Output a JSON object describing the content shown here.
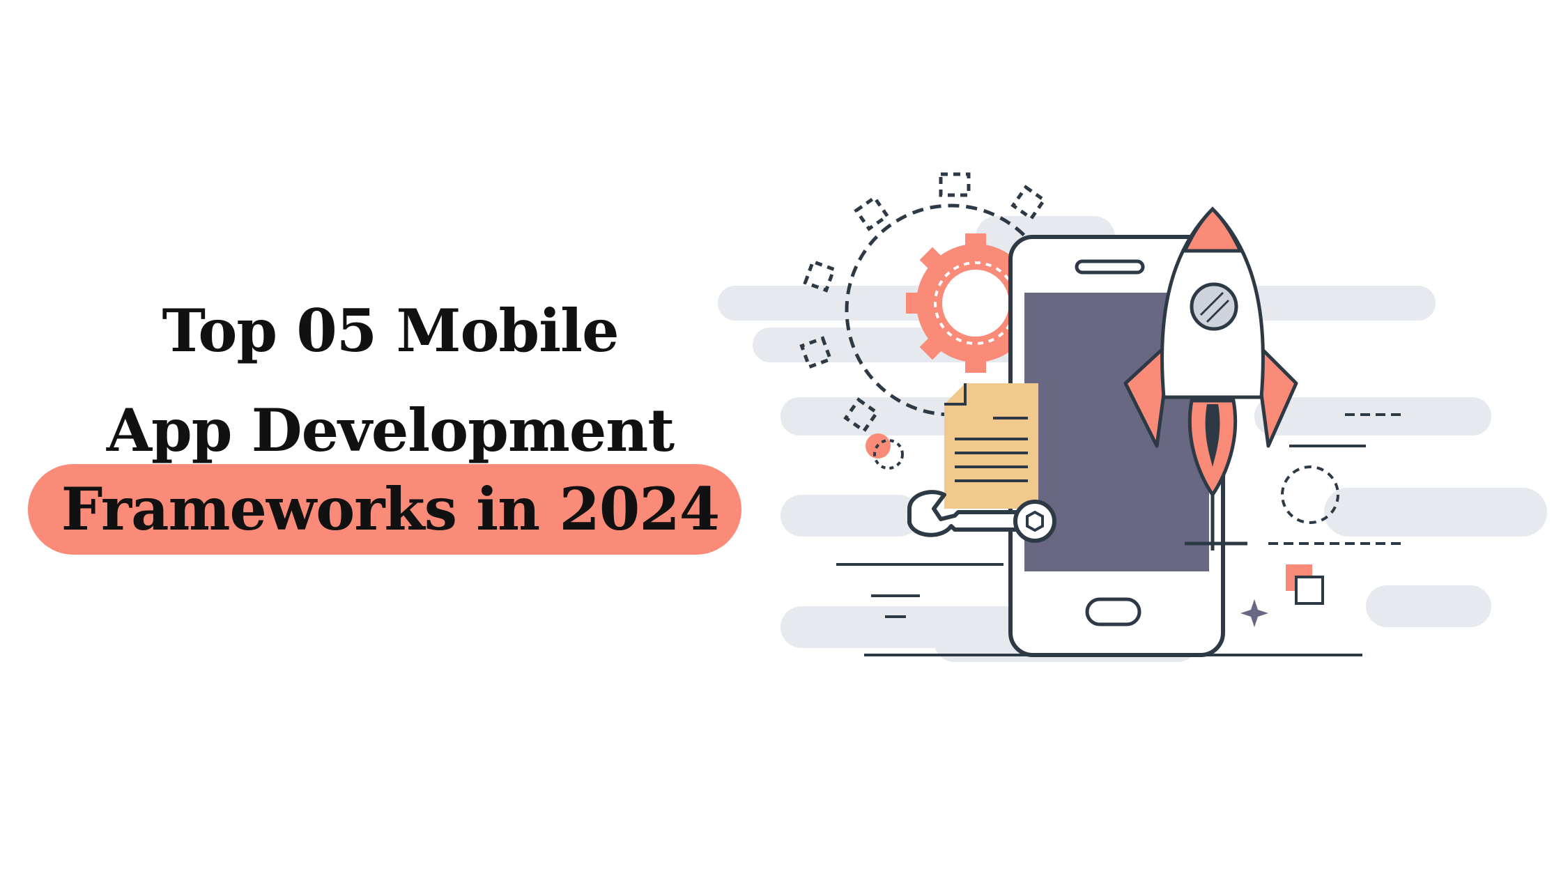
{
  "headline": {
    "line1": "Top 05 Mobile",
    "line2": "App Development",
    "line3": "Frameworks in 2024"
  },
  "colors": {
    "accent": "#f98b78",
    "text": "#111111",
    "outline": "#2d3a45",
    "screen": "#686882",
    "cloud": "#e6e9ee",
    "document": "#f2c98c"
  },
  "illustration": {
    "icons": [
      "gear-icon",
      "smartphone-icon",
      "rocket-icon",
      "document-icon",
      "wrench-icon",
      "sparkle-icon"
    ]
  }
}
